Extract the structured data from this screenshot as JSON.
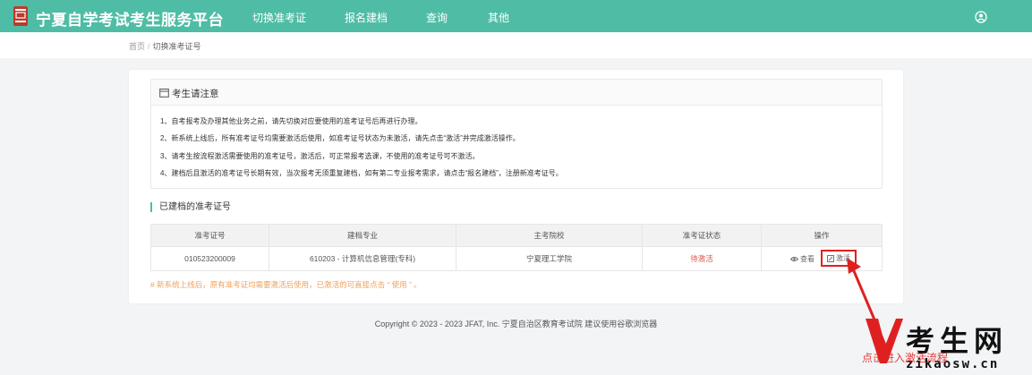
{
  "app": {
    "title": "宁夏自学考试考生服务平台"
  },
  "nav": {
    "items": [
      "切换准考证",
      "报名建档",
      "查询",
      "其他"
    ]
  },
  "breadcrumb": {
    "home": "首页",
    "separator": "/",
    "current": "切换准考证号"
  },
  "notice": {
    "title": "考生请注意",
    "lines": [
      "1、自考报考及办理其他业务之前，请先切换对应要使用的准考证号后再进行办理。",
      "2、新系统上线后，所有准考证号均需要激活后使用，如准考证号状态为未激活，请先点击“激活”并完成激活操作。",
      "3、请考生按流程激活需要使用的准考证号，激活后，可正常报考选课，不使用的准考证号可不激活。",
      "4、建档后且激活的准考证号长期有效，当次报考无须重复建档，如有第二专业报考需求，请点击“报名建档”，注册新准考证号。"
    ]
  },
  "section": {
    "title": "已建档的准考证号"
  },
  "table": {
    "headers": [
      "准考证号",
      "建档专业",
      "主考院校",
      "准考证状态",
      "操作"
    ],
    "rows": [
      {
        "exam_id": "010523200009",
        "major": "610203 - 计算机信息管理(专科)",
        "school": "宁夏理工学院",
        "status": "待激活",
        "view_label": "查看",
        "activate_label": "激活"
      }
    ]
  },
  "footnote": "# 新系统上线后，原有准考证均需要激活后使用，已激活的可直接点击 “ 使用 ” 。",
  "copyright": "Copyright © 2023 - 2023 JFAT, Inc. 宁夏自治区教育考试院 建议使用谷歌浏览器",
  "watermark": {
    "brand": "考生网",
    "url": "zikaosw.cn",
    "annotation": "点击进入激活流程"
  },
  "icons": {
    "logo": "seal-logo-icon",
    "user": "user-circle-icon",
    "notice": "calendar-icon",
    "view": "eye-icon",
    "activate": "edit-icon"
  },
  "colors": {
    "brand": "#4fbda5",
    "status_pending": "#e05a4e",
    "footnote": "#f0a15b",
    "highlight": "#e02020"
  }
}
